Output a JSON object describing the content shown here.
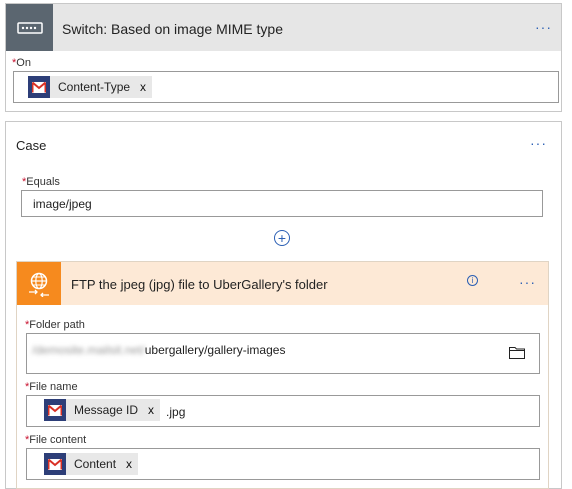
{
  "switch": {
    "title": "Switch: Based on image MIME type",
    "more": "···",
    "on_label": "On",
    "required_mark": "*",
    "on_token": "Content-Type",
    "token_remove": "x"
  },
  "case": {
    "title": "Case",
    "more": "···",
    "equals_label": "Equals",
    "equals_value": "image/jpeg",
    "add_symbol": "+"
  },
  "ftp": {
    "title": "FTP the jpeg (jpg) file to UberGallery's folder",
    "more": "···",
    "folder_path_label": "Folder path",
    "folder_path_prefix": "/demosite.mailsit.net/",
    "folder_path_value": "ubergallery/gallery-images",
    "file_name_label": "File name",
    "file_name_token": "Message ID",
    "file_name_suffix": ".jpg",
    "file_content_label": "File content",
    "file_content_token": "Content",
    "token_remove": "x"
  }
}
